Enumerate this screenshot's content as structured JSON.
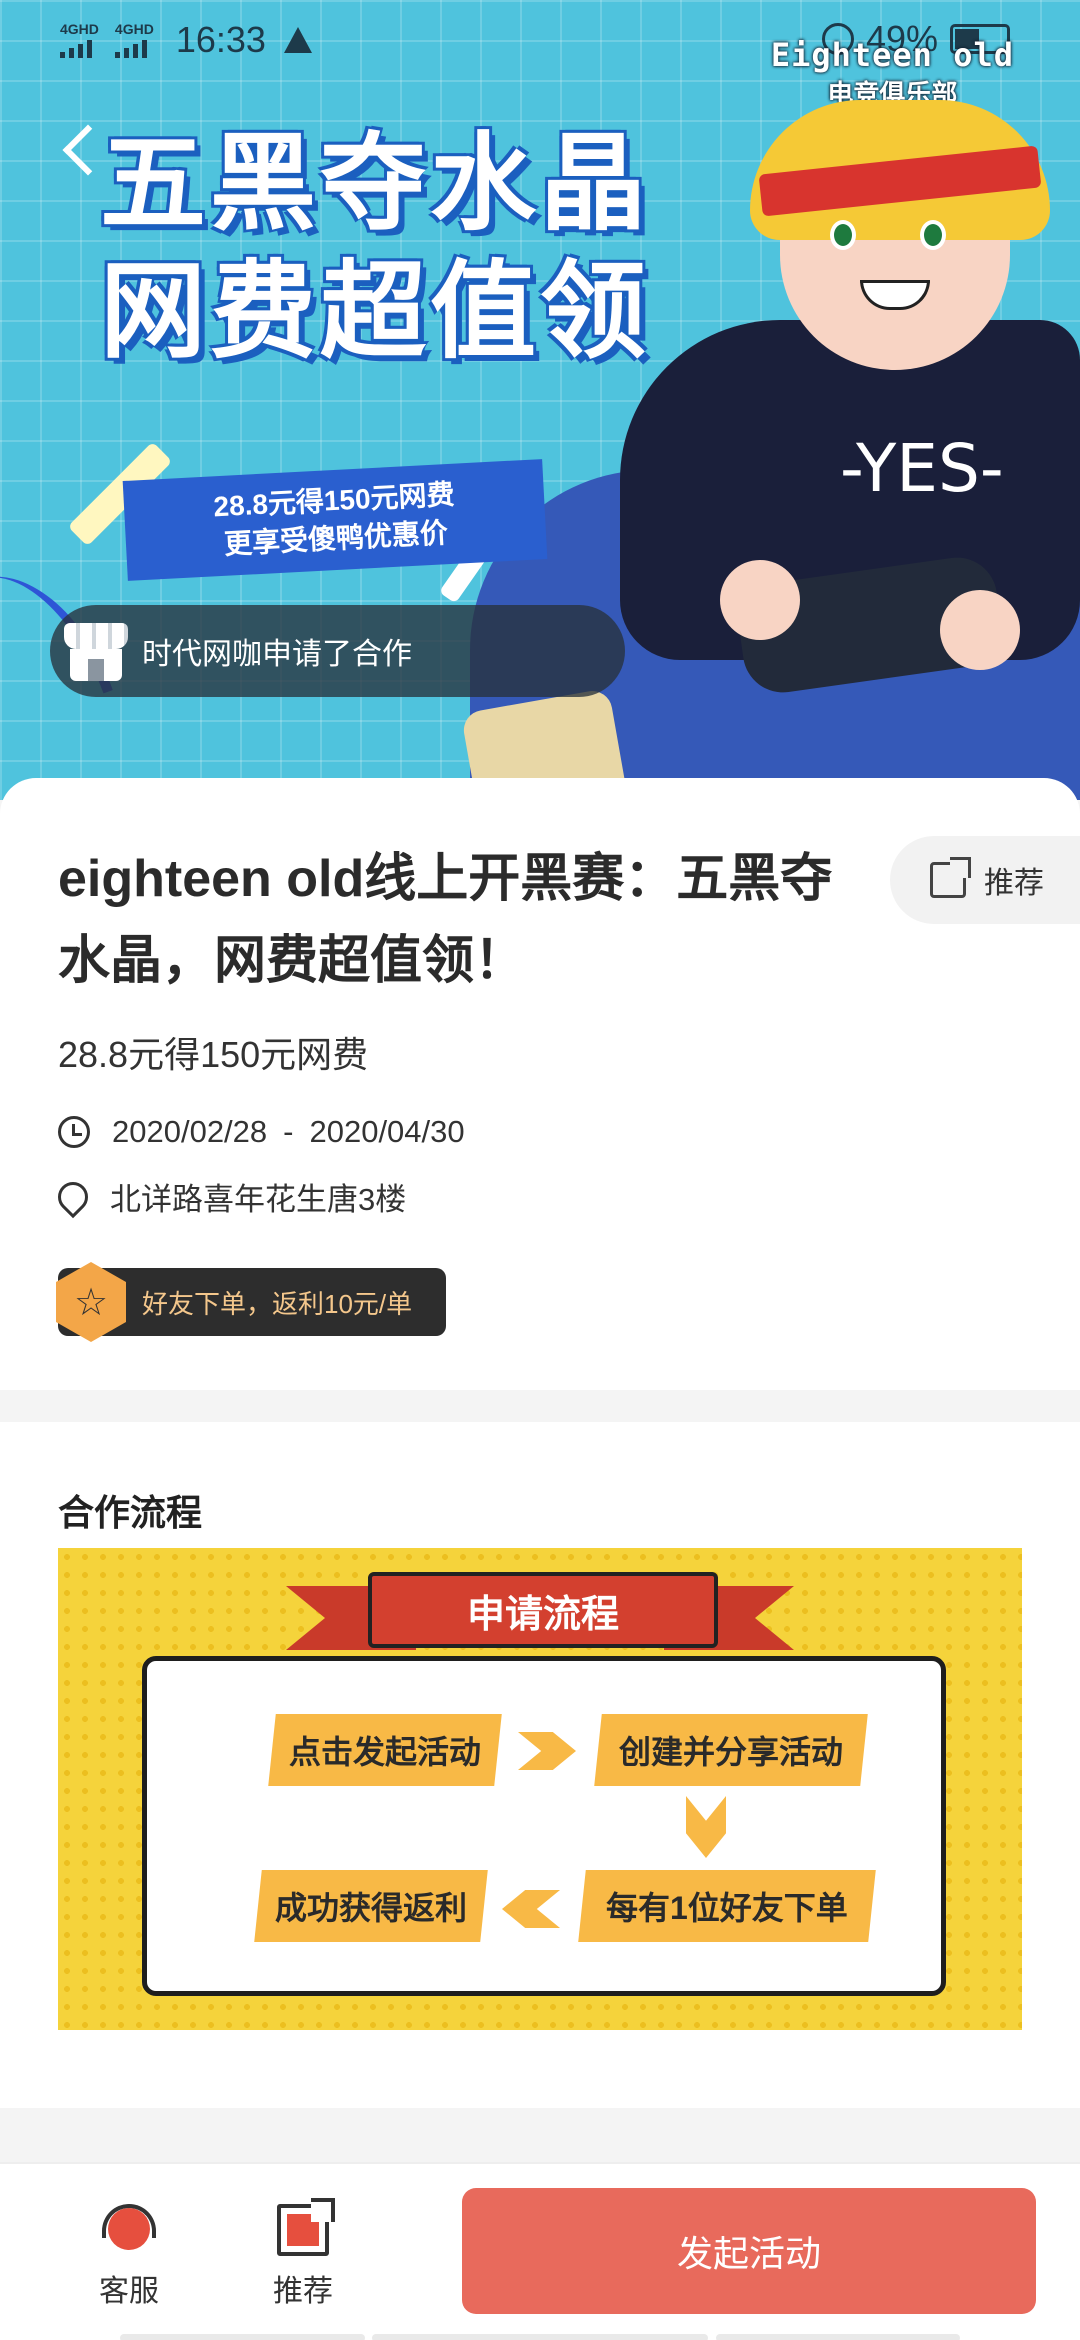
{
  "status_bar": {
    "network_1": "4GHD",
    "network_2": "4GHD",
    "time": "16:33",
    "battery": "49%"
  },
  "banner": {
    "club_name_en": "Eighteen old",
    "club_name_cn": "电竞俱乐部",
    "headline_line1": "五黑夺水晶",
    "headline_line2": "网费超值领",
    "promo_line1": "28.8元得150元网费",
    "promo_line2": "更享受傻鸭优惠价",
    "shirt_text": "-YES-",
    "cooperation_notice": "时代网咖申请了合作"
  },
  "event": {
    "title": "eighteen  old线上开黑赛：五黑夺水晶，网费超值领！",
    "share_label": "推荐",
    "subtitle": "28.8元得150元网费",
    "date_start": "2020/02/28",
    "date_sep": "-",
    "date_end": "2020/04/30",
    "address": "北详路喜年花生唐3楼",
    "rebate_text": "好友下单，返利10元/单",
    "rebate_icon": "☆"
  },
  "cooperation": {
    "section_title": "合作流程",
    "flow_title": "申请流程",
    "steps": [
      "点击发起活动",
      "创建并分享活动",
      "每有1位好友下单",
      "成功获得返利"
    ]
  },
  "bottom_bar": {
    "service_label": "客服",
    "recommend_label": "推荐",
    "launch_label": "发起活动"
  },
  "colors": {
    "accent": "#e86a5c",
    "banner_bg": "#4fc3dd",
    "flow_bg": "#f5d33b",
    "step_bg": "#f8b946",
    "ribbon": "#d3402f"
  }
}
